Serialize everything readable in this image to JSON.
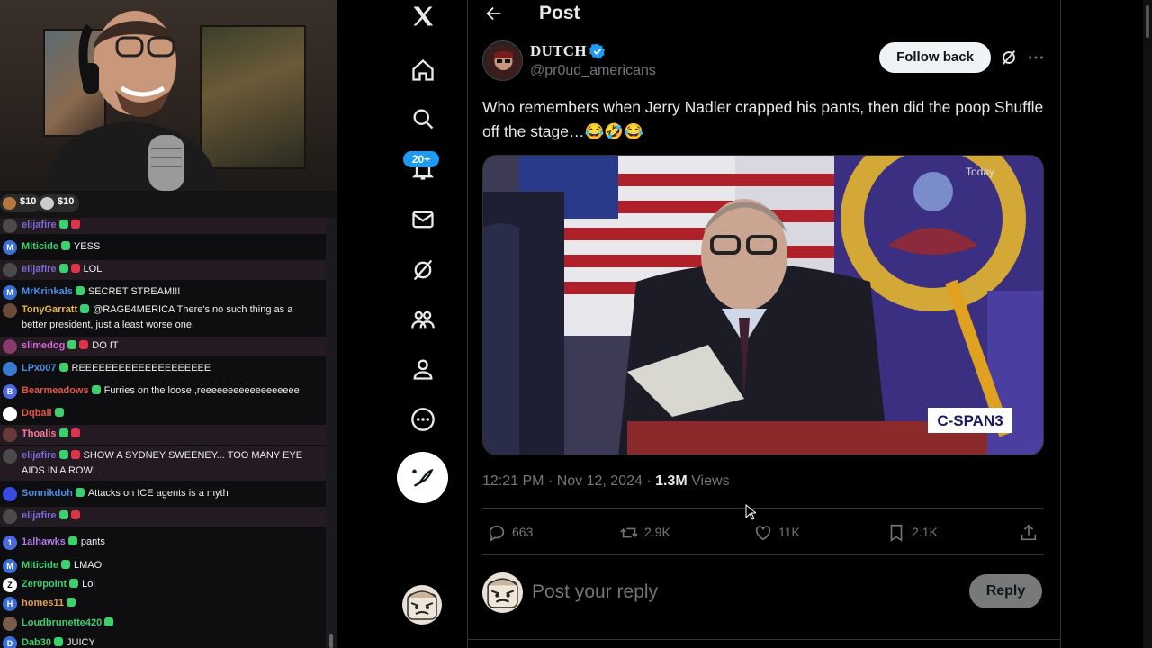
{
  "stream": {
    "tips": [
      {
        "amount": "$10",
        "coin_color": "#b4793a"
      },
      {
        "amount": "$10",
        "coin_color": "#cccccc"
      }
    ],
    "chat": [
      {
        "user": "elijafire",
        "color": "#7c6cd6",
        "avatar_color": "#4a4a4a",
        "text": "",
        "highlight": true
      },
      {
        "user": "Miticide",
        "color": "#3ecf6e",
        "avatar_color": "#3b6fd6",
        "avatar_letter": "M",
        "text": "YESS",
        "highlight": false
      },
      {
        "user": "elijafire",
        "color": "#7c6cd6",
        "avatar_color": "#4a4a4a",
        "text": "LOL",
        "highlight": true
      },
      {
        "user": "MrKrinkals",
        "color": "#4a8fe6",
        "avatar_color": "#3b6fd6",
        "avatar_letter": "M",
        "text": "SECRET STREAM!!!",
        "highlight": false
      },
      {
        "user": "TonyGarratt",
        "color": "#e6b84a",
        "avatar_color": "#6b4a3a",
        "text": "@RAGE4MERICA There's no such thing as a better president, just a least worse one.",
        "highlight": false
      },
      {
        "user": "slimedog",
        "color": "#d46ad8",
        "avatar_color": "#8a3a6a",
        "text": "DO IT",
        "highlight": true
      },
      {
        "user": "LPx007",
        "color": "#4a8fe6",
        "avatar_color": "#3a7ad0",
        "text": "REEEEEEEEEEEEEEEEEEEE",
        "highlight": false
      },
      {
        "user": "Bearmeadows",
        "color": "#e6554a",
        "avatar_color": "#4b6be0",
        "avatar_letter": "B",
        "text": "Furries on the loose ,reeeeeeeeeeeeeeeeee",
        "highlight": false
      },
      {
        "user": "Dqball",
        "color": "#e6554a",
        "avatar_color": "#ffffff",
        "text": "",
        "highlight": false
      },
      {
        "user": "Thoalis",
        "color": "#ff7a9a",
        "avatar_color": "#6a3a3a",
        "text": "",
        "highlight": true
      },
      {
        "user": "elijafire",
        "color": "#7c6cd6",
        "avatar_color": "#4a4a4a",
        "text": "SHOW A SYDNEY SWEENEY... TOO MANY EYE AIDS IN A ROW!",
        "highlight": true
      },
      {
        "user": "Sonnikdoh",
        "color": "#4a8fe6",
        "avatar_color": "#3a4ae0",
        "text": "Attacks on ICE agents is a myth",
        "highlight": false
      },
      {
        "user": "elijafire",
        "color": "#7c6cd6",
        "avatar_color": "#4a4a4a",
        "text": "",
        "highlight": true
      },
      {
        "user": "1alhawks",
        "color": "#b47ae6",
        "avatar_color": "#4b6be0",
        "avatar_letter": "1",
        "text": "pants",
        "highlight": false
      },
      {
        "user": "Miticide",
        "color": "#3ecf6e",
        "avatar_color": "#3b6fd6",
        "avatar_letter": "M",
        "text": "LMAO",
        "highlight": false
      },
      {
        "user": "Zer0point",
        "color": "#3ecf6e",
        "avatar_color": "#ffffff",
        "avatar_letter": "Z",
        "text": "Lol",
        "highlight": false
      },
      {
        "user": "homes11",
        "color": "#e69a4a",
        "avatar_color": "#3b6fd6",
        "avatar_letter": "H",
        "text": "",
        "highlight": false
      },
      {
        "user": "Loudbrunette420",
        "color": "#3ecf6e",
        "avatar_color": "#7a5a4a",
        "text": "",
        "highlight": false
      },
      {
        "user": "Dab30",
        "color": "#3ecf6e",
        "avatar_color": "#3b6fd6",
        "avatar_letter": "D",
        "text": "JUICY",
        "highlight": false
      }
    ]
  },
  "nav": {
    "items": [
      "x-logo-icon",
      "home-icon",
      "search-icon",
      "notifications-icon",
      "messages-icon",
      "grok-icon",
      "communities-icon",
      "profile-icon",
      "more-icon"
    ],
    "notif_badge": "20+",
    "accent": "#1d9bf0"
  },
  "post": {
    "header_title": "Post",
    "author_name": "DUTCH",
    "author_handle": "@pr0ud_americans",
    "follow_label": "Follow back",
    "text": "Who remembers when Jerry Nadler crapped his pants, then did the poop Shuffle off the stage…😂🤣😂",
    "media_overlay": "Today",
    "media_logo": "C-SPAN3",
    "time": "12:21 PM",
    "dot": "·",
    "date": "Nov 12, 2024",
    "views_count": "1.3M",
    "views_label": "Views",
    "replies": "663",
    "reposts": "2.9K",
    "likes": "11K",
    "bookmarks": "2.1K",
    "reply_placeholder": "Post your reply",
    "reply_button": "Reply"
  }
}
